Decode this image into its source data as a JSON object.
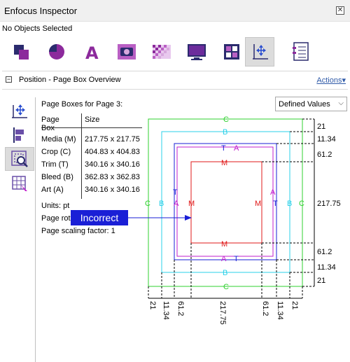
{
  "window": {
    "title": "Enfocus Inspector",
    "close": "✕"
  },
  "selection_status": "No Objects Selected",
  "toolbar": {
    "tools": [
      {
        "icon": "objects-icon",
        "active": false
      },
      {
        "icon": "color-pie-icon",
        "active": false
      },
      {
        "icon": "text-icon",
        "active": false
      },
      {
        "icon": "image-camera-icon",
        "active": false
      },
      {
        "icon": "transparency-icon",
        "active": false
      },
      {
        "icon": "monitor-icon",
        "active": false
      },
      {
        "icon": "separations-icon",
        "active": false
      },
      {
        "icon": "position-icon",
        "active": true
      },
      {
        "icon": "document-info-icon",
        "active": false
      }
    ]
  },
  "section": {
    "collapse": "−",
    "title": "Position - Page Box Overview",
    "actions": "Actions"
  },
  "page_boxes": {
    "title": "Page Boxes for Page 3:",
    "dropdown_value": "Defined Values",
    "headers": [
      "Page Box",
      "Size"
    ],
    "rows": [
      {
        "name": "Media (M)",
        "size": "217.75 x 217.75"
      },
      {
        "name": "Crop (C)",
        "size": "404.83 x 404.83"
      },
      {
        "name": "Trim (T)",
        "size": "340.16 x 340.16"
      },
      {
        "name": "Bleed (B)",
        "size": "362.83 x 362.83"
      },
      {
        "name": "Art (A)",
        "size": "340.16 x 340.16"
      }
    ],
    "units": "Units: pt",
    "rotation": "Page rotation: 0",
    "scaling": "Page scaling factor: 1"
  },
  "callout": "Incorrect",
  "diagram": {
    "colors": {
      "C": "#2fd12f",
      "B": "#29d0e8",
      "T": "#1a1fd6",
      "A": "#c21ccd",
      "M": "#e01818"
    },
    "box_letters": {
      "C": "C",
      "B": "B",
      "T": "T",
      "A": "A",
      "M": "M"
    },
    "right_values": [
      "21",
      "11.34",
      "61.2",
      "217.75",
      "61.2",
      "11.34",
      "21"
    ],
    "bottom_values": [
      "21",
      "11.34",
      "61.2",
      "217.75",
      "61.2",
      "11.34",
      "21"
    ]
  }
}
